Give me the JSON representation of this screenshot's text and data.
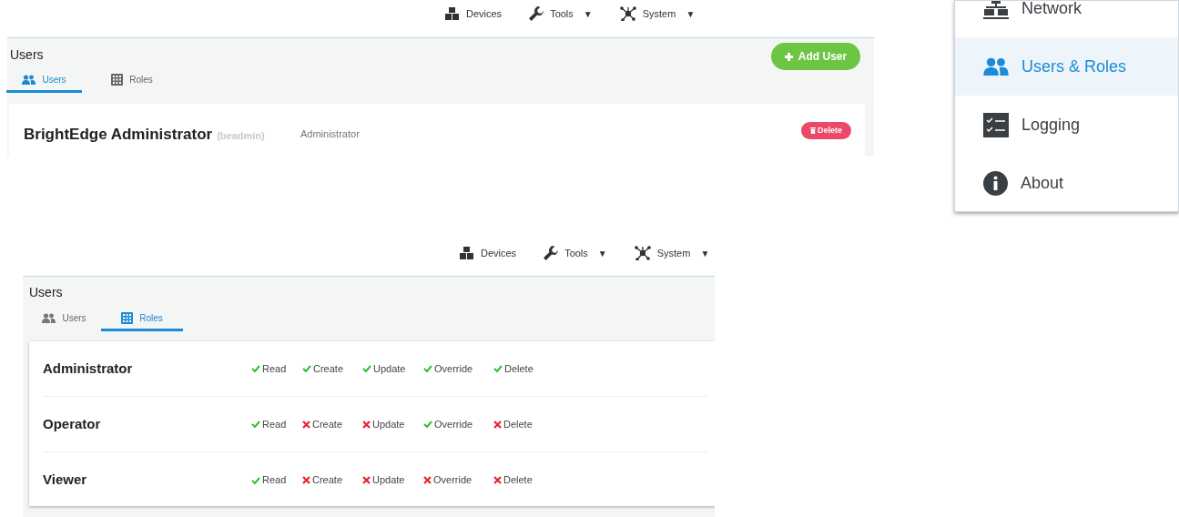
{
  "users_screen": {
    "nav": [
      {
        "label": "Devices"
      },
      {
        "label": "Tools",
        "caret": "▼"
      },
      {
        "label": "System",
        "caret": "▼"
      }
    ],
    "title": "Users",
    "tabs": [
      {
        "label": "Users",
        "selected": true
      },
      {
        "label": "Roles",
        "selected": false
      }
    ],
    "add_button": "Add User",
    "users": [
      {
        "name": "BrightEdge Administrator",
        "username": "(beadmin)",
        "role": "Administrator",
        "delete": "Delete"
      }
    ]
  },
  "system_menu": {
    "items": [
      {
        "label": "Network",
        "selected": false
      },
      {
        "label": "Users & Roles",
        "selected": true
      },
      {
        "label": "Logging",
        "selected": false
      },
      {
        "label": "About",
        "selected": false
      }
    ]
  },
  "roles_screen": {
    "nav": [
      {
        "label": "Devices"
      },
      {
        "label": "Tools",
        "caret": "▼"
      },
      {
        "label": "System",
        "caret": "▼"
      }
    ],
    "title": "Users",
    "tabs": [
      {
        "label": "Users",
        "selected": false
      },
      {
        "label": "Roles",
        "selected": true
      }
    ],
    "roles": [
      {
        "name": "Administrator",
        "permissions": [
          {
            "label": "Read",
            "granted": true
          },
          {
            "label": "Create",
            "granted": true
          },
          {
            "label": "Update",
            "granted": true
          },
          {
            "label": "Override",
            "granted": true
          },
          {
            "label": "Delete",
            "granted": true
          }
        ]
      },
      {
        "name": "Operator",
        "permissions": [
          {
            "label": "Read",
            "granted": true
          },
          {
            "label": "Create",
            "granted": false
          },
          {
            "label": "Update",
            "granted": false
          },
          {
            "label": "Override",
            "granted": true
          },
          {
            "label": "Delete",
            "granted": false
          }
        ]
      },
      {
        "name": "Viewer",
        "permissions": [
          {
            "label": "Read",
            "granted": true
          },
          {
            "label": "Create",
            "granted": false
          },
          {
            "label": "Update",
            "granted": false
          },
          {
            "label": "Override",
            "granted": false
          },
          {
            "label": "Delete",
            "granted": false
          }
        ]
      }
    ]
  }
}
